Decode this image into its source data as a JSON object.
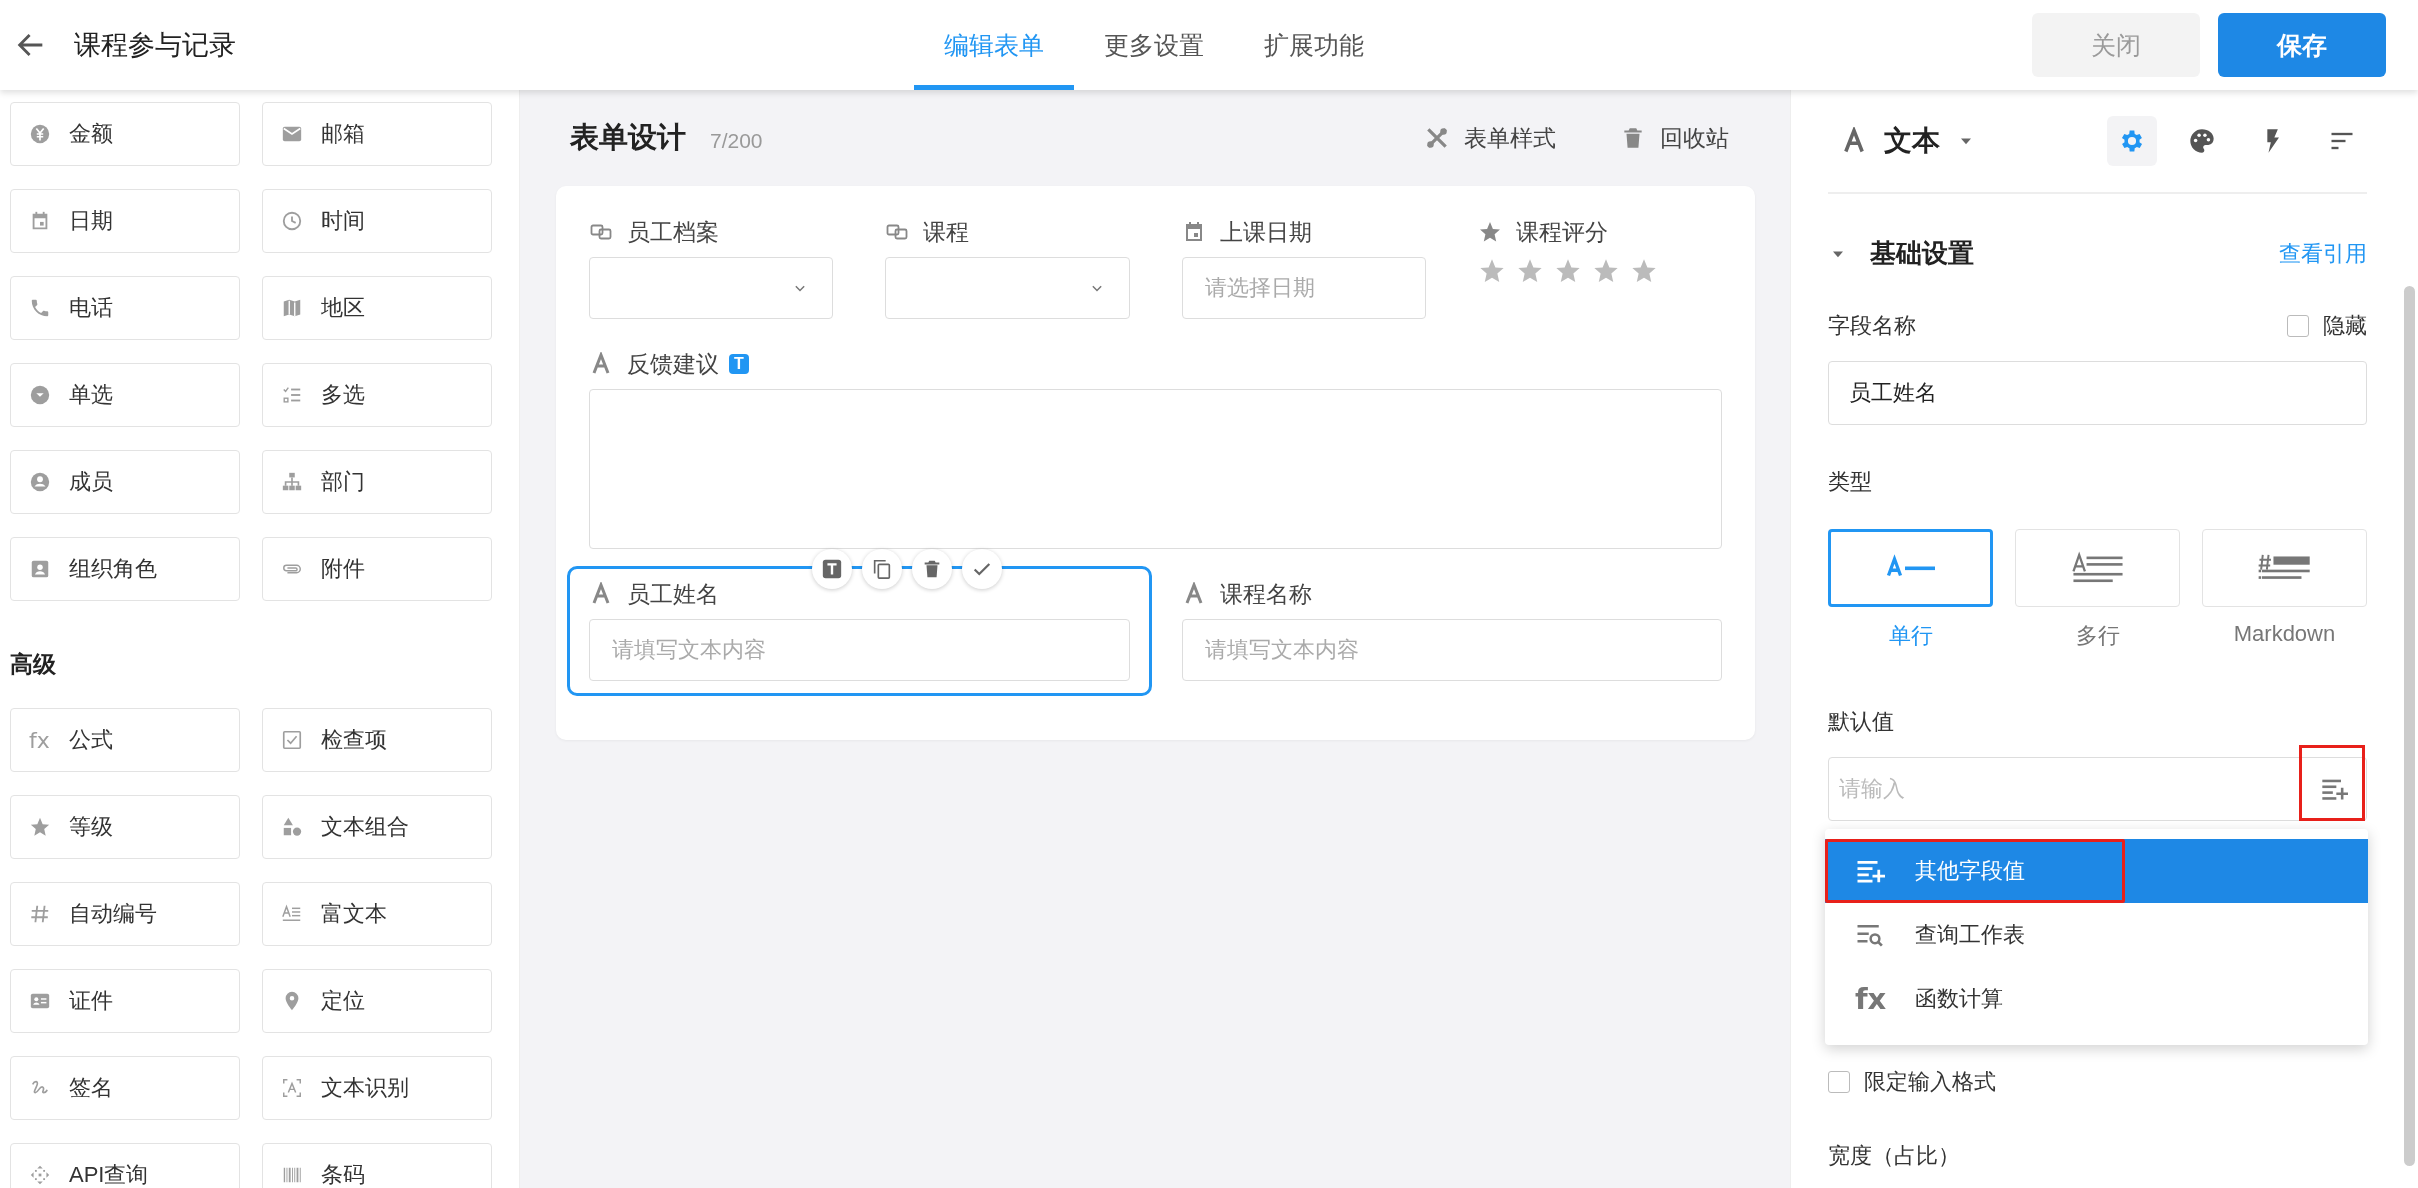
{
  "header": {
    "title": "课程参与记录",
    "tabs": [
      {
        "label": "编辑表单",
        "selected": true
      },
      {
        "label": "更多设置",
        "selected": false
      },
      {
        "label": "扩展功能",
        "selected": false
      }
    ],
    "buttons": [
      {
        "label": "关闭",
        "kind": "secondary"
      },
      {
        "label": "保存",
        "kind": "primary"
      }
    ]
  },
  "palette": {
    "basic_items": [
      {
        "label": "金额"
      },
      {
        "label": "邮箱"
      },
      {
        "label": "日期"
      },
      {
        "label": "时间"
      },
      {
        "label": "电话"
      },
      {
        "label": "地区"
      },
      {
        "label": "单选"
      },
      {
        "label": "多选"
      },
      {
        "label": "成员"
      },
      {
        "label": "部门"
      },
      {
        "label": "组织角色"
      },
      {
        "label": "附件"
      }
    ],
    "advanced": {
      "title": "高级",
      "items": [
        {
          "label": "公式",
          "glyph": "fx"
        },
        {
          "label": "检查项"
        },
        {
          "label": "等级"
        },
        {
          "label": "文本组合"
        },
        {
          "label": "自动编号"
        },
        {
          "label": "富文本"
        },
        {
          "label": "证件"
        },
        {
          "label": "定位"
        },
        {
          "label": "签名"
        },
        {
          "label": "文本识别"
        },
        {
          "label": "API查询"
        },
        {
          "label": "条码"
        }
      ]
    }
  },
  "canvas": {
    "title": "表单设计",
    "count": "7/200",
    "actions": [
      {
        "label": "表单样式"
      },
      {
        "label": "回收站"
      }
    ],
    "fields": [
      {
        "label": "员工档案",
        "kind": "relation",
        "selected": false
      },
      {
        "label": "课程",
        "kind": "relation",
        "selected": false
      },
      {
        "label": "上课日期",
        "kind": "date",
        "placeholder": "请选择日期",
        "selected": false
      },
      {
        "label": "课程评分",
        "kind": "rating",
        "stars": 0,
        "selected": false
      },
      {
        "label": "反馈建议",
        "kind": "textarea",
        "badge": "T",
        "selected": false
      },
      {
        "label": "员工姓名",
        "kind": "text",
        "placeholder": "请填写文本内容",
        "selected": true
      },
      {
        "label": "课程名称",
        "kind": "text",
        "placeholder": "请填写文本内容",
        "selected": false
      }
    ]
  },
  "props": {
    "field_type": "文本",
    "tools": [
      {
        "selected": true
      },
      {
        "selected": false
      },
      {
        "selected": false
      },
      {
        "selected": false
      }
    ],
    "section": {
      "title": "基础设置",
      "expanded": true,
      "link": "查看引用"
    },
    "name_field": {
      "label": "字段名称",
      "value": "员工姓名"
    },
    "hide": {
      "label": "隐藏",
      "checked": false
    },
    "type": {
      "label": "类型",
      "options": [
        {
          "label": "单行",
          "selected": true
        },
        {
          "label": "多行",
          "selected": false
        },
        {
          "label": "Markdown",
          "selected": false
        }
      ]
    },
    "default": {
      "label": "默认值",
      "placeholder": "请输入",
      "highlighted": true
    },
    "menu": {
      "items": [
        {
          "label": "其他字段值",
          "selected": true,
          "highlighted": true
        },
        {
          "label": "查询工作表",
          "selected": false,
          "highlighted": false
        },
        {
          "label": "函数计算",
          "glyph": "fx",
          "selected": false,
          "highlighted": false
        }
      ]
    },
    "checks": [
      {
        "label": "限定输入格式",
        "checked": false
      }
    ],
    "width": {
      "label": "宽度（占比）"
    }
  }
}
